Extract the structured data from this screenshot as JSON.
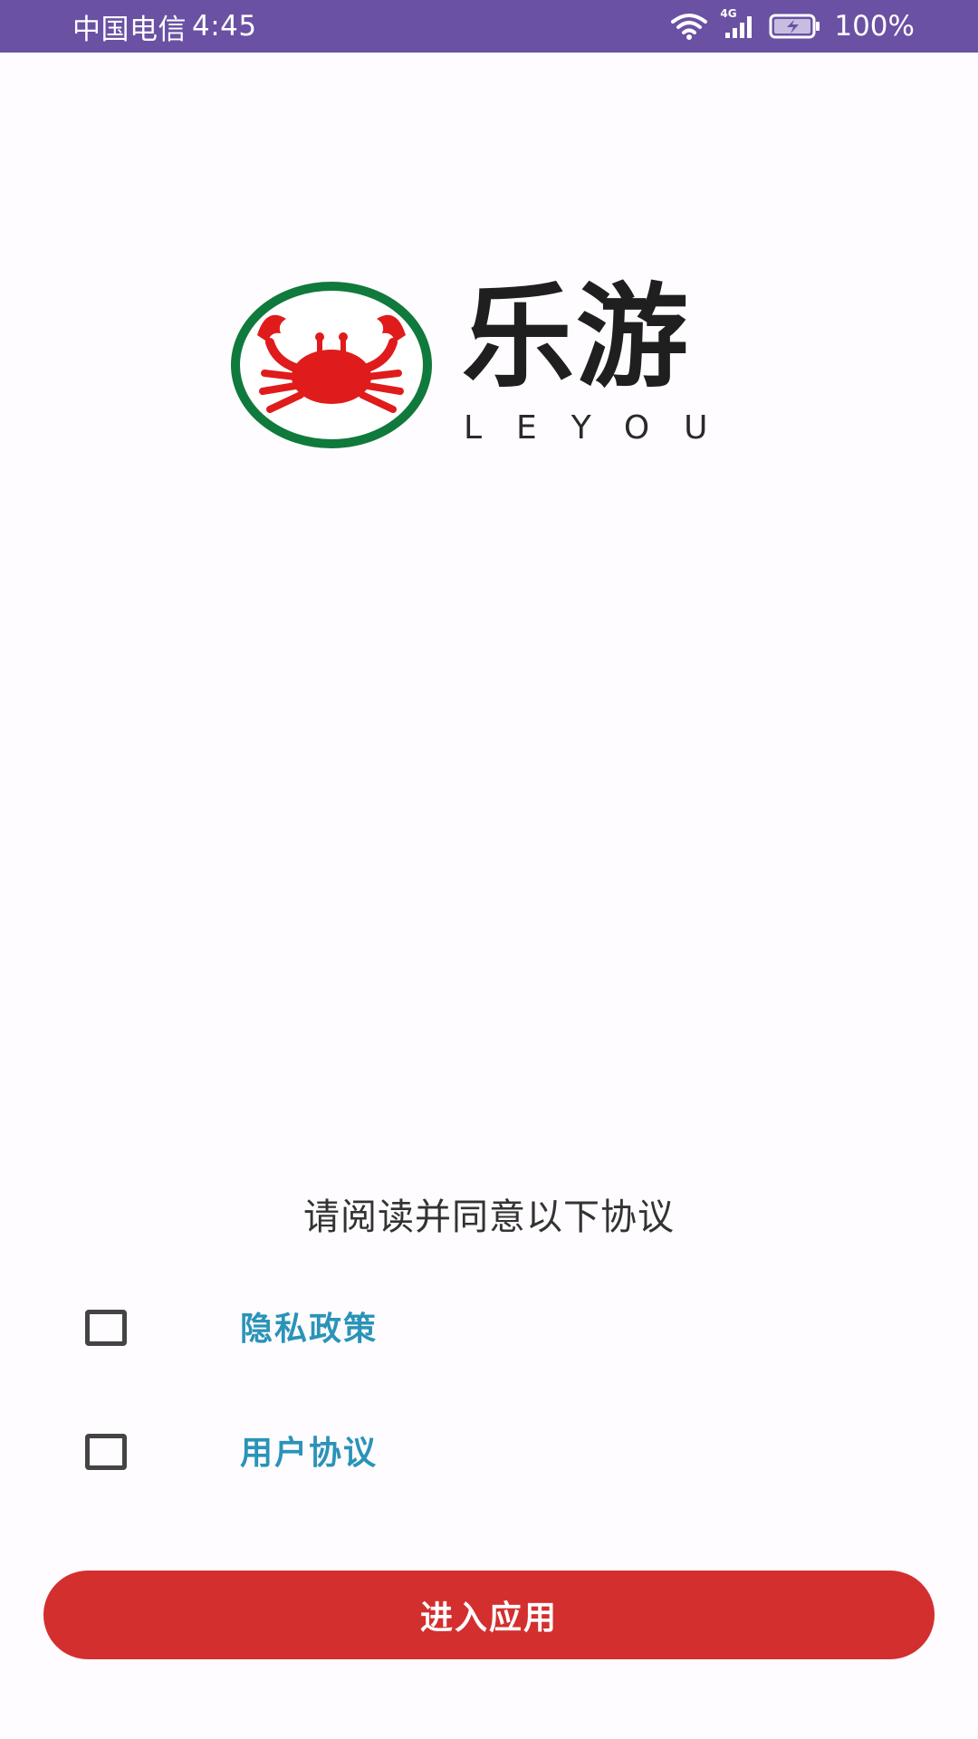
{
  "status_bar": {
    "carrier": "中国电信",
    "time": "4:45",
    "network": "4G",
    "battery": "100%"
  },
  "logo": {
    "name_cn": "乐游",
    "name_en": "LEYOU",
    "emblem_icon": "crab-icon",
    "colors": {
      "ring": "#0f7a3c",
      "crab": "#e01b1b"
    }
  },
  "agreement": {
    "title": "请阅读并同意以下协议",
    "items": [
      {
        "label": "隐私政策",
        "checked": false
      },
      {
        "label": "用户协议",
        "checked": false
      }
    ]
  },
  "enter_button": {
    "label": "进入应用"
  },
  "colors": {
    "status_bar": "#6a51a3",
    "link": "#2a93b8",
    "button": "#d32f2f",
    "background": "#fefcfe"
  }
}
